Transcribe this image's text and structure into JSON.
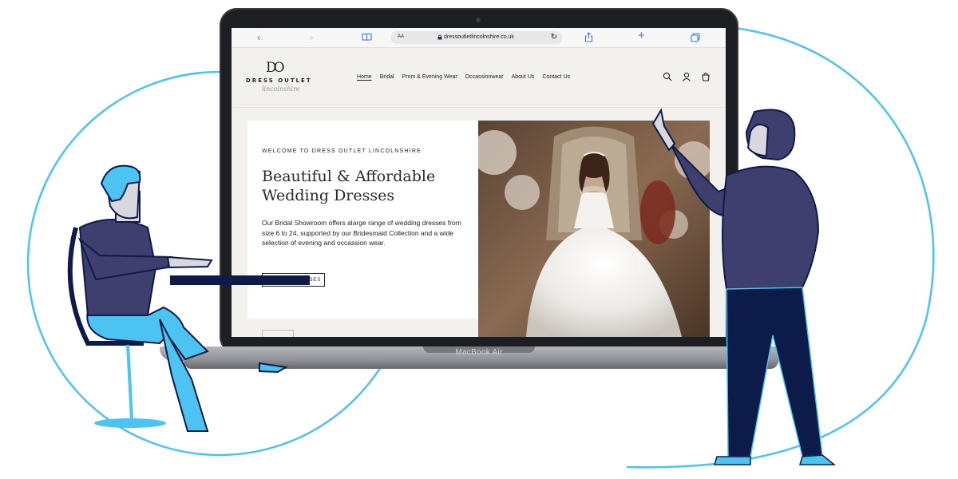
{
  "browser": {
    "text_size_label": "AA",
    "url": "dressoutletlincolnshire.co.uk"
  },
  "site": {
    "logo_monogram": "DO",
    "logo_name": "DRESS OUTLET",
    "logo_script": "lincolnshire",
    "nav": [
      {
        "label": "Home",
        "active": true
      },
      {
        "label": "Bridal"
      },
      {
        "label": "Prom & Evening Wear"
      },
      {
        "label": "Occassionwear"
      },
      {
        "label": "About Us"
      },
      {
        "label": "Contact Us"
      }
    ]
  },
  "hero": {
    "eyebrow": "WELCOME TO DRESS OUTLET LINCOLNSHIRE",
    "headline_line1": "Beautiful & Affordable",
    "headline_line2": "Wedding Dresses",
    "body": "Our Bridal Showroom offers alarge range of wedding dresses from size 6 to 24, supported by our Bridesmaid Collection and a wide selection of evening and occassion wear.",
    "cta_partial": "SES"
  },
  "device": {
    "model": "MacBook Air"
  },
  "colors": {
    "accent": "#4cc3f0",
    "navy": "#0d1b4a",
    "purple": "#3e3f6e",
    "page_bg": "#f3f1ee",
    "ios_blue": "#2f7cf6"
  }
}
